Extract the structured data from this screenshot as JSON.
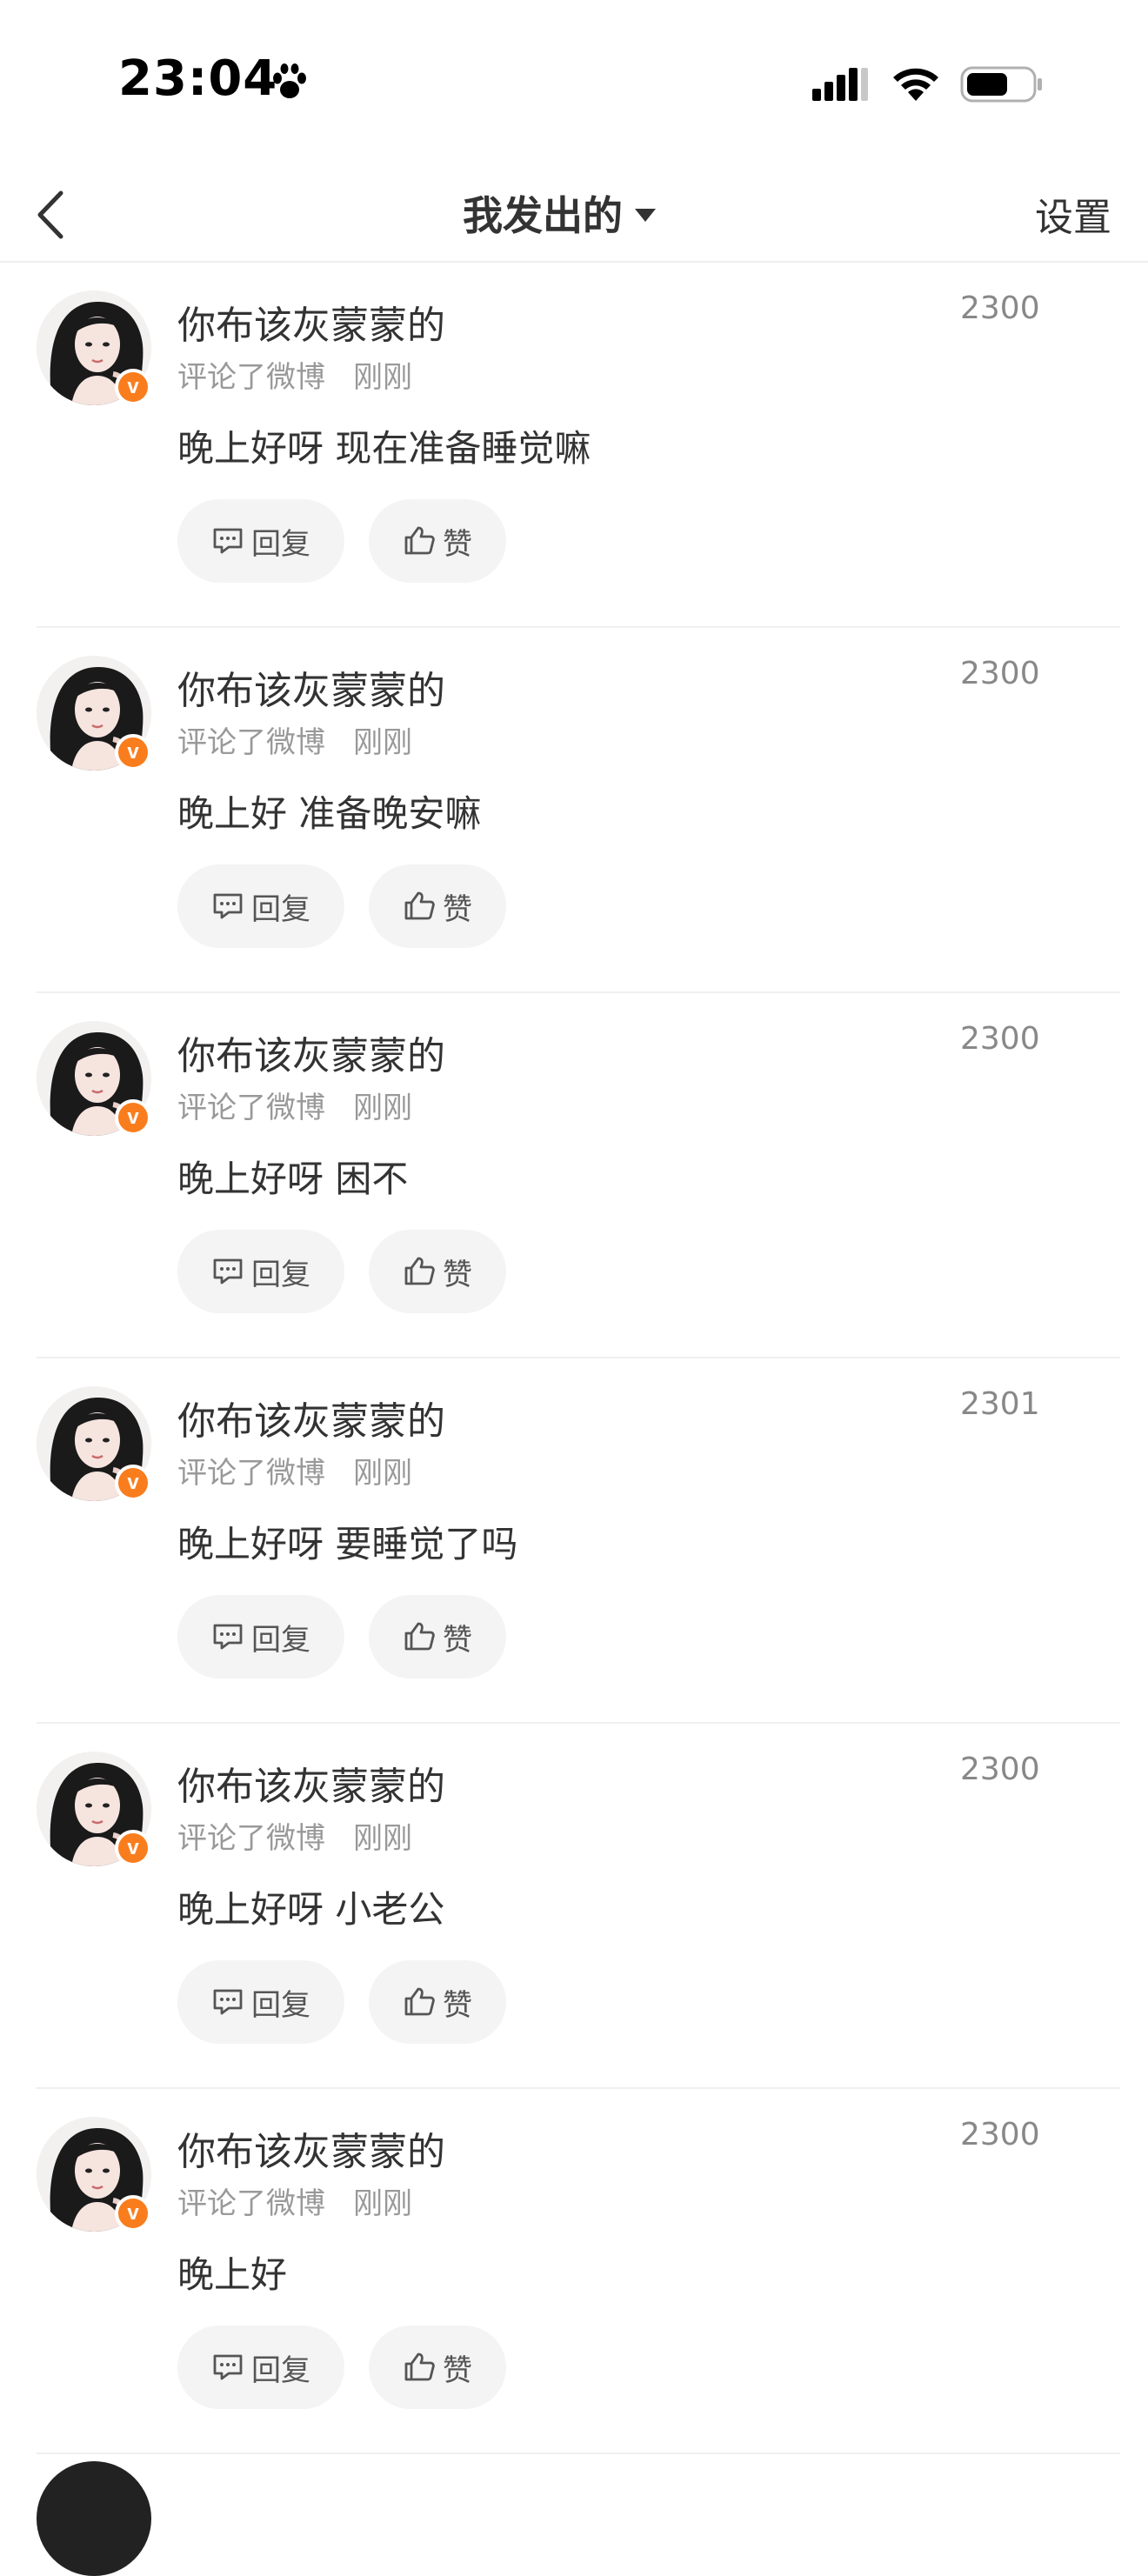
{
  "status_bar": {
    "time": "23:04"
  },
  "nav": {
    "title": "我发出的",
    "settings_label": "设置"
  },
  "comments": [
    {
      "name": "你布该灰蒙蒙的",
      "action": "评论了微博",
      "time": "刚刚",
      "text": "晚上好呀 现在准备睡觉嘛",
      "count": "2300",
      "reply_label": "回复",
      "like_label": "赞"
    },
    {
      "name": "你布该灰蒙蒙的",
      "action": "评论了微博",
      "time": "刚刚",
      "text": "晚上好 准备晚安嘛",
      "count": "2300",
      "reply_label": "回复",
      "like_label": "赞"
    },
    {
      "name": "你布该灰蒙蒙的",
      "action": "评论了微博",
      "time": "刚刚",
      "text": "晚上好呀 困不",
      "count": "2300",
      "reply_label": "回复",
      "like_label": "赞"
    },
    {
      "name": "你布该灰蒙蒙的",
      "action": "评论了微博",
      "time": "刚刚",
      "text": "晚上好呀 要睡觉了吗",
      "count": "2301",
      "reply_label": "回复",
      "like_label": "赞"
    },
    {
      "name": "你布该灰蒙蒙的",
      "action": "评论了微博",
      "time": "刚刚",
      "text": "晚上好呀 小老公",
      "count": "2300",
      "reply_label": "回复",
      "like_label": "赞"
    },
    {
      "name": "你布该灰蒙蒙的",
      "action": "评论了微博",
      "time": "刚刚",
      "text": "晚上好",
      "count": "2300",
      "reply_label": "回复",
      "like_label": "赞"
    }
  ],
  "badge_letter": "v",
  "colors": {
    "badge": "#fa7d1d",
    "button_bg": "#f4f4f4",
    "divider": "#efefef"
  }
}
